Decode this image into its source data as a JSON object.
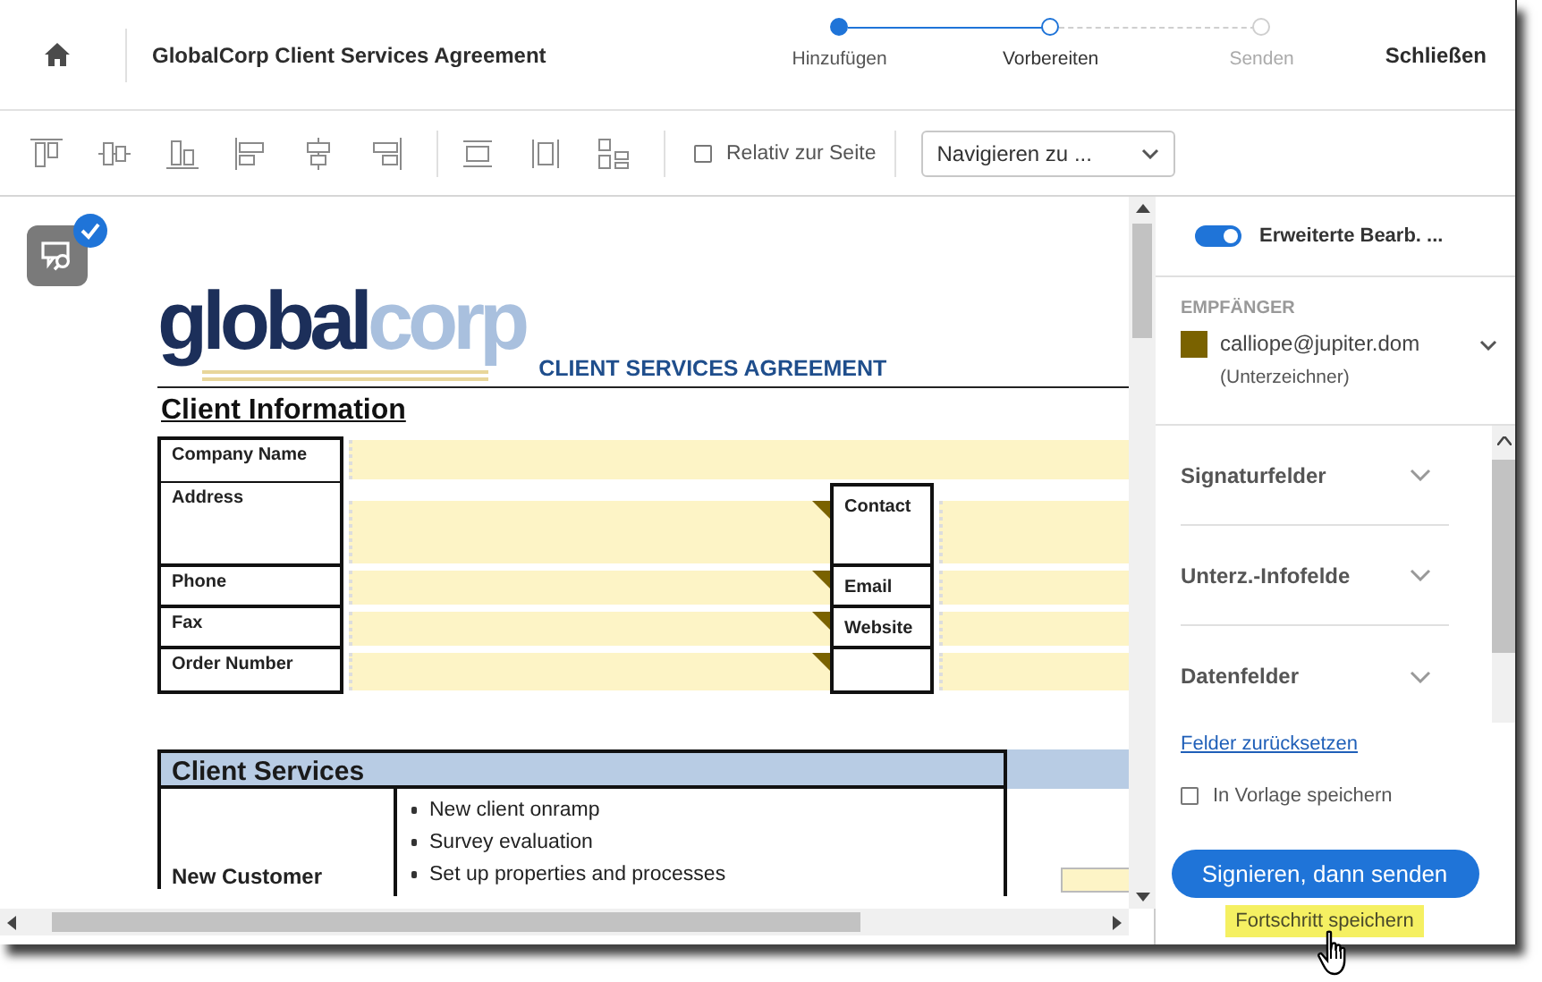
{
  "header": {
    "title": "GlobalCorp Client Services Agreement",
    "close": "Schließen"
  },
  "steps": [
    {
      "label": "Hinzufügen",
      "completed": true,
      "selected": false
    },
    {
      "label": "Vorbereiten",
      "completed": false,
      "selected": true
    },
    {
      "label": "Senden",
      "completed": false,
      "selected": false
    }
  ],
  "toolbar": {
    "relative_to_page": {
      "label": "Relativ zur Seite",
      "checked": false
    },
    "navigate": {
      "value": "Navigieren zu ..."
    }
  },
  "document": {
    "logo_parts": [
      "global",
      "corp"
    ],
    "heading": "CLIENT SERVICES AGREEMENT",
    "section_title": "Client Information",
    "client_rows": [
      {
        "label": "Company Name",
        "kind": "wide"
      },
      {
        "label": "Address",
        "kind": "split",
        "right_label": "Contact"
      },
      {
        "label": "Phone",
        "kind": "split",
        "right_label": "Email"
      },
      {
        "label": "Fax",
        "kind": "split",
        "right_label": "Website"
      },
      {
        "label": "Order Number",
        "kind": "split"
      }
    ],
    "services": {
      "title": "Client Services",
      "rows": [
        {
          "label": "New Customer",
          "items": [
            "New client onramp",
            "Survey evaluation",
            "Set up properties and processes"
          ]
        }
      ]
    }
  },
  "panel": {
    "advanced": {
      "label": "Erweiterte Bearb. ...",
      "on": true
    },
    "recipients_heading": "EMPFÄNGER",
    "recipient": {
      "email": "calliope@jupiter.dom",
      "role": "(Unterzeichner)",
      "color": "#7a6200"
    },
    "sections": [
      {
        "label": "Signaturfelder",
        "expanded": false
      },
      {
        "label": "Unterz.-Infofelde",
        "expanded": false
      },
      {
        "label": "Datenfelder",
        "expanded": false
      }
    ],
    "reset_link": "Felder zurücksetzen",
    "save_template": {
      "label": "In Vorlage speichern",
      "checked": false
    },
    "primary_button": "Signieren, dann senden",
    "save_progress": "Fortschritt speichern"
  }
}
